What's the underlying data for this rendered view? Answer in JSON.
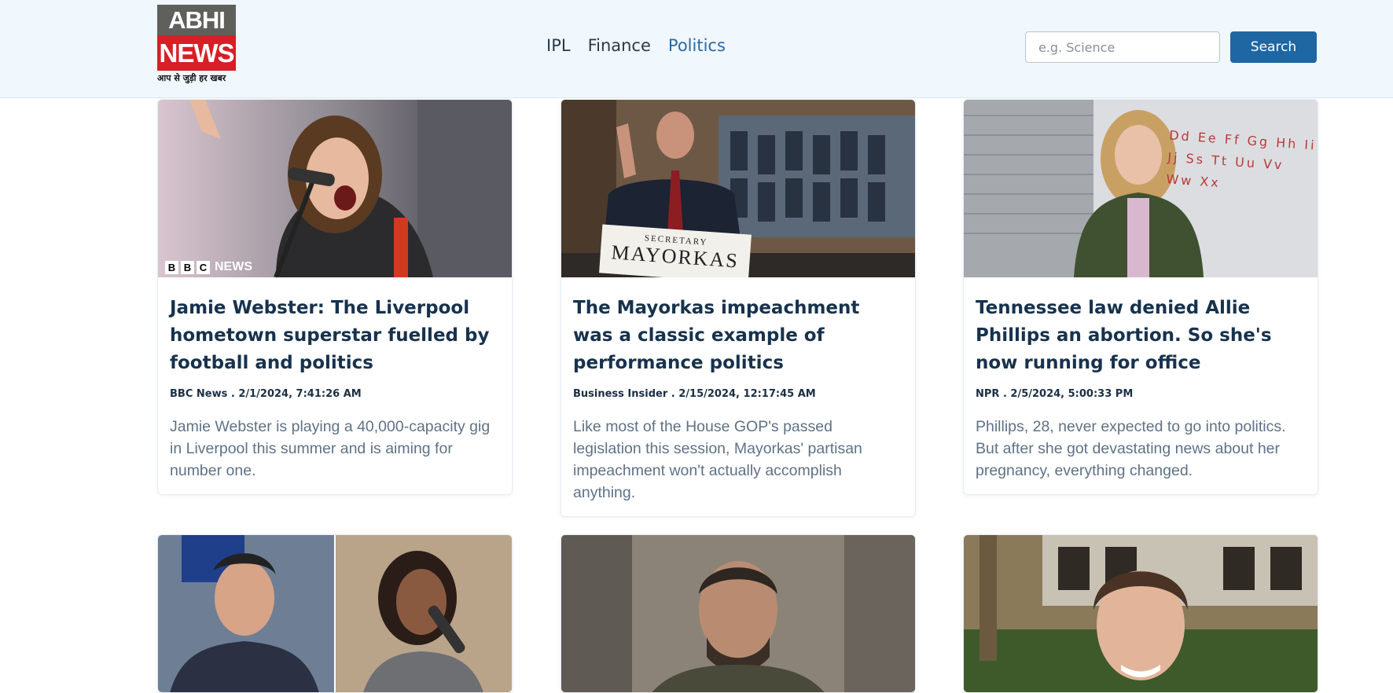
{
  "header": {
    "logo": {
      "line1": "ABHI",
      "line2": "NEWS",
      "tagline": "आप से जुड़ी हर खबर"
    },
    "nav": [
      {
        "label": "IPL",
        "active": false
      },
      {
        "label": "Finance",
        "active": false
      },
      {
        "label": "Politics",
        "active": true
      }
    ],
    "search": {
      "placeholder": "e.g. Science",
      "value": "",
      "button_label": "Search"
    }
  },
  "articles": [
    {
      "title": "Jamie Webster: The Liverpool hometown superstar fuelled by football and politics",
      "meta": "BBC News . 2/1/2024, 7:41:26 AM",
      "description": "Jamie Webster is playing a 40,000-capacity gig in Liverpool this summer and is aiming for number one.",
      "image_badge": {
        "b1": "B",
        "b2": "B",
        "b3": "C",
        "word": "NEWS"
      }
    },
    {
      "title": "The Mayorkas impeachment was a classic example of performance politics",
      "meta": "Business Insider . 2/15/2024, 12:17:45 AM",
      "description": "Like most of the House GOP's passed legislation this session, Mayorkas' partisan impeachment won't actually accomplish anything.",
      "image_sign": {
        "small": "SECRETARY",
        "big": "MAYORKAS"
      }
    },
    {
      "title": "Tennessee law denied Allie Phillips an abortion. So she's now running for office",
      "meta": "NPR . 2/5/2024, 5:00:33 PM",
      "description": "Phillips, 28, never expected to go into politics. But after she got devastating news about her pregnancy, everything changed.",
      "image_alphabet": "Dd Ee Ff Gg Hh Ii Jj Ss Tt Uu Vv Ww Xx"
    },
    {
      "title": "",
      "meta": "",
      "description": ""
    },
    {
      "title": "",
      "meta": "",
      "description": ""
    },
    {
      "title": "",
      "meta": "",
      "description": ""
    }
  ],
  "colors": {
    "navbar_bg": "#f0f7fd",
    "accent": "#1f67a3",
    "title": "#17324d",
    "description": "#5f7286",
    "logo_red": "#d71f26"
  }
}
